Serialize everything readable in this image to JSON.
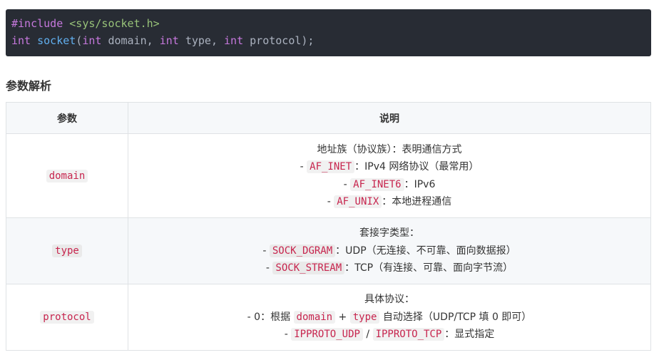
{
  "code": {
    "line1": {
      "directive": "#include",
      "header": "<sys/socket.h>"
    },
    "line2": {
      "ret_type": "int",
      "fn_name": "socket",
      "open": "(",
      "p1_type": "int",
      "p1_name": " domain, ",
      "p2_type": "int",
      "p2_name": " type, ",
      "p3_type": "int",
      "p3_name": " protocol);"
    }
  },
  "section": {
    "title": "参数解析"
  },
  "table": {
    "headers": {
      "param": "参数",
      "desc": "说明"
    },
    "rows": [
      {
        "param": "domain",
        "lines": [
          {
            "text": "地址族（协议族）：表明通信方式"
          },
          {
            "prefix": "- ",
            "code": "AF_INET",
            "suffix": "：IPv4 网络协议（最常用）"
          },
          {
            "prefix": "- ",
            "code": "AF_INET6",
            "suffix": "：IPv6"
          },
          {
            "prefix": "- ",
            "code": "AF_UNIX",
            "suffix": "：本地进程通信"
          }
        ]
      },
      {
        "param": "type",
        "lines": [
          {
            "text": "套接字类型："
          },
          {
            "prefix": "- ",
            "code": "SOCK_DGRAM",
            "suffix": "：UDP（无连接、不可靠、面向数据报）"
          },
          {
            "prefix": "- ",
            "code": "SOCK_STREAM",
            "suffix": "：TCP（有连接、可靠、面向字节流）"
          }
        ]
      },
      {
        "param": "protocol",
        "lines": [
          {
            "text": "具体协议："
          },
          {
            "prefix": "- 0：根据 ",
            "code": "domain",
            "mid": " + ",
            "code2": "type",
            "suffix": " 自动选择（UDP/TCP 填 0 即可）"
          },
          {
            "prefix": "- ",
            "code": "IPPROTO_UDP",
            "mid": " / ",
            "code2": "IPPROTO_TCP",
            "suffix": "：显式指定"
          }
        ]
      }
    ]
  }
}
